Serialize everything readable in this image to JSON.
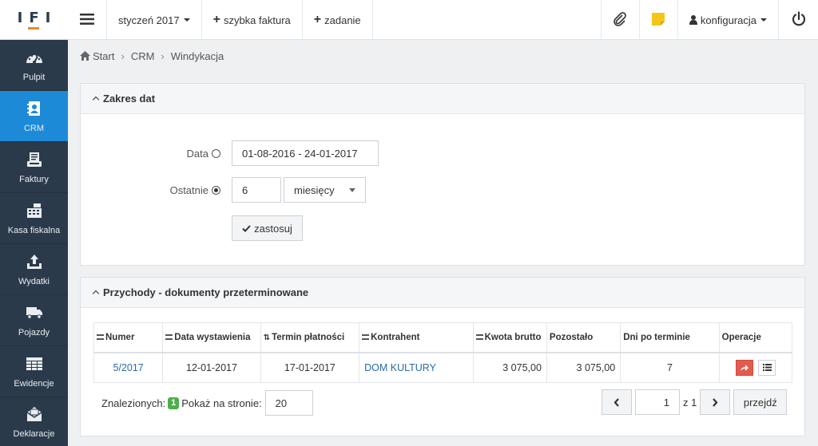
{
  "logo": {
    "text": "IFI"
  },
  "sidebar": {
    "items": [
      {
        "label": "Pulpit",
        "icon": "dashboard-icon",
        "active": false
      },
      {
        "label": "CRM",
        "icon": "address-book-icon",
        "active": true
      },
      {
        "label": "Faktury",
        "icon": "receipt-icon",
        "active": false
      },
      {
        "label": "Kasa fiskalna",
        "icon": "cash-register-icon",
        "active": false
      },
      {
        "label": "Wydatki",
        "icon": "upload-tray-icon",
        "active": false
      },
      {
        "label": "Pojazdy",
        "icon": "truck-icon",
        "active": false
      },
      {
        "label": "Ewidencje",
        "icon": "table-icon",
        "active": false
      },
      {
        "label": "Deklaracje",
        "icon": "envelope-icon",
        "active": false
      }
    ]
  },
  "topbar": {
    "period": "styczeń 2017",
    "quick_invoice": "szybka faktura",
    "task": "zadanie",
    "config": "konfiguracja"
  },
  "breadcrumb": {
    "start": "Start",
    "crm": "CRM",
    "current": "Windykacja"
  },
  "date_panel": {
    "title": "Zakres dat",
    "date_label": "Data",
    "date_value": "01-08-2016 - 24-01-2017",
    "last_label": "Ostatnie",
    "last_value": "6",
    "unit_value": "miesięcy",
    "mode": "ostatnie",
    "apply_label": "zastosuj"
  },
  "docs_panel": {
    "title": "Przychody - dokumenty przeterminowane",
    "columns": [
      "Numer",
      "Data wystawienia",
      "Termin płatności",
      "Kontrahent",
      "Kwota brutto",
      "Pozostało",
      "Dni po terminie",
      "Operacje"
    ],
    "rows": [
      {
        "numer": "5/2017",
        "data_wystawienia": "12-01-2017",
        "termin": "17-01-2017",
        "kontrahent": "DOM KULTURY",
        "kwota": "3 075,00",
        "pozostalo": "3 075,00",
        "dni": "7"
      }
    ],
    "found_label": "Znalezionych:",
    "found_count": "1",
    "per_page_label": "Pokaż na stronie:",
    "per_page_value": "20",
    "page_value": "1",
    "page_of": "z 1",
    "goto_label": "przejdź"
  },
  "colors": {
    "sidebar": "#2b3a4a",
    "active": "#1d8ad8",
    "accent": "#e8892b",
    "danger": "#e25b4f",
    "badge": "#4cae4c",
    "note": "#f5c518"
  }
}
